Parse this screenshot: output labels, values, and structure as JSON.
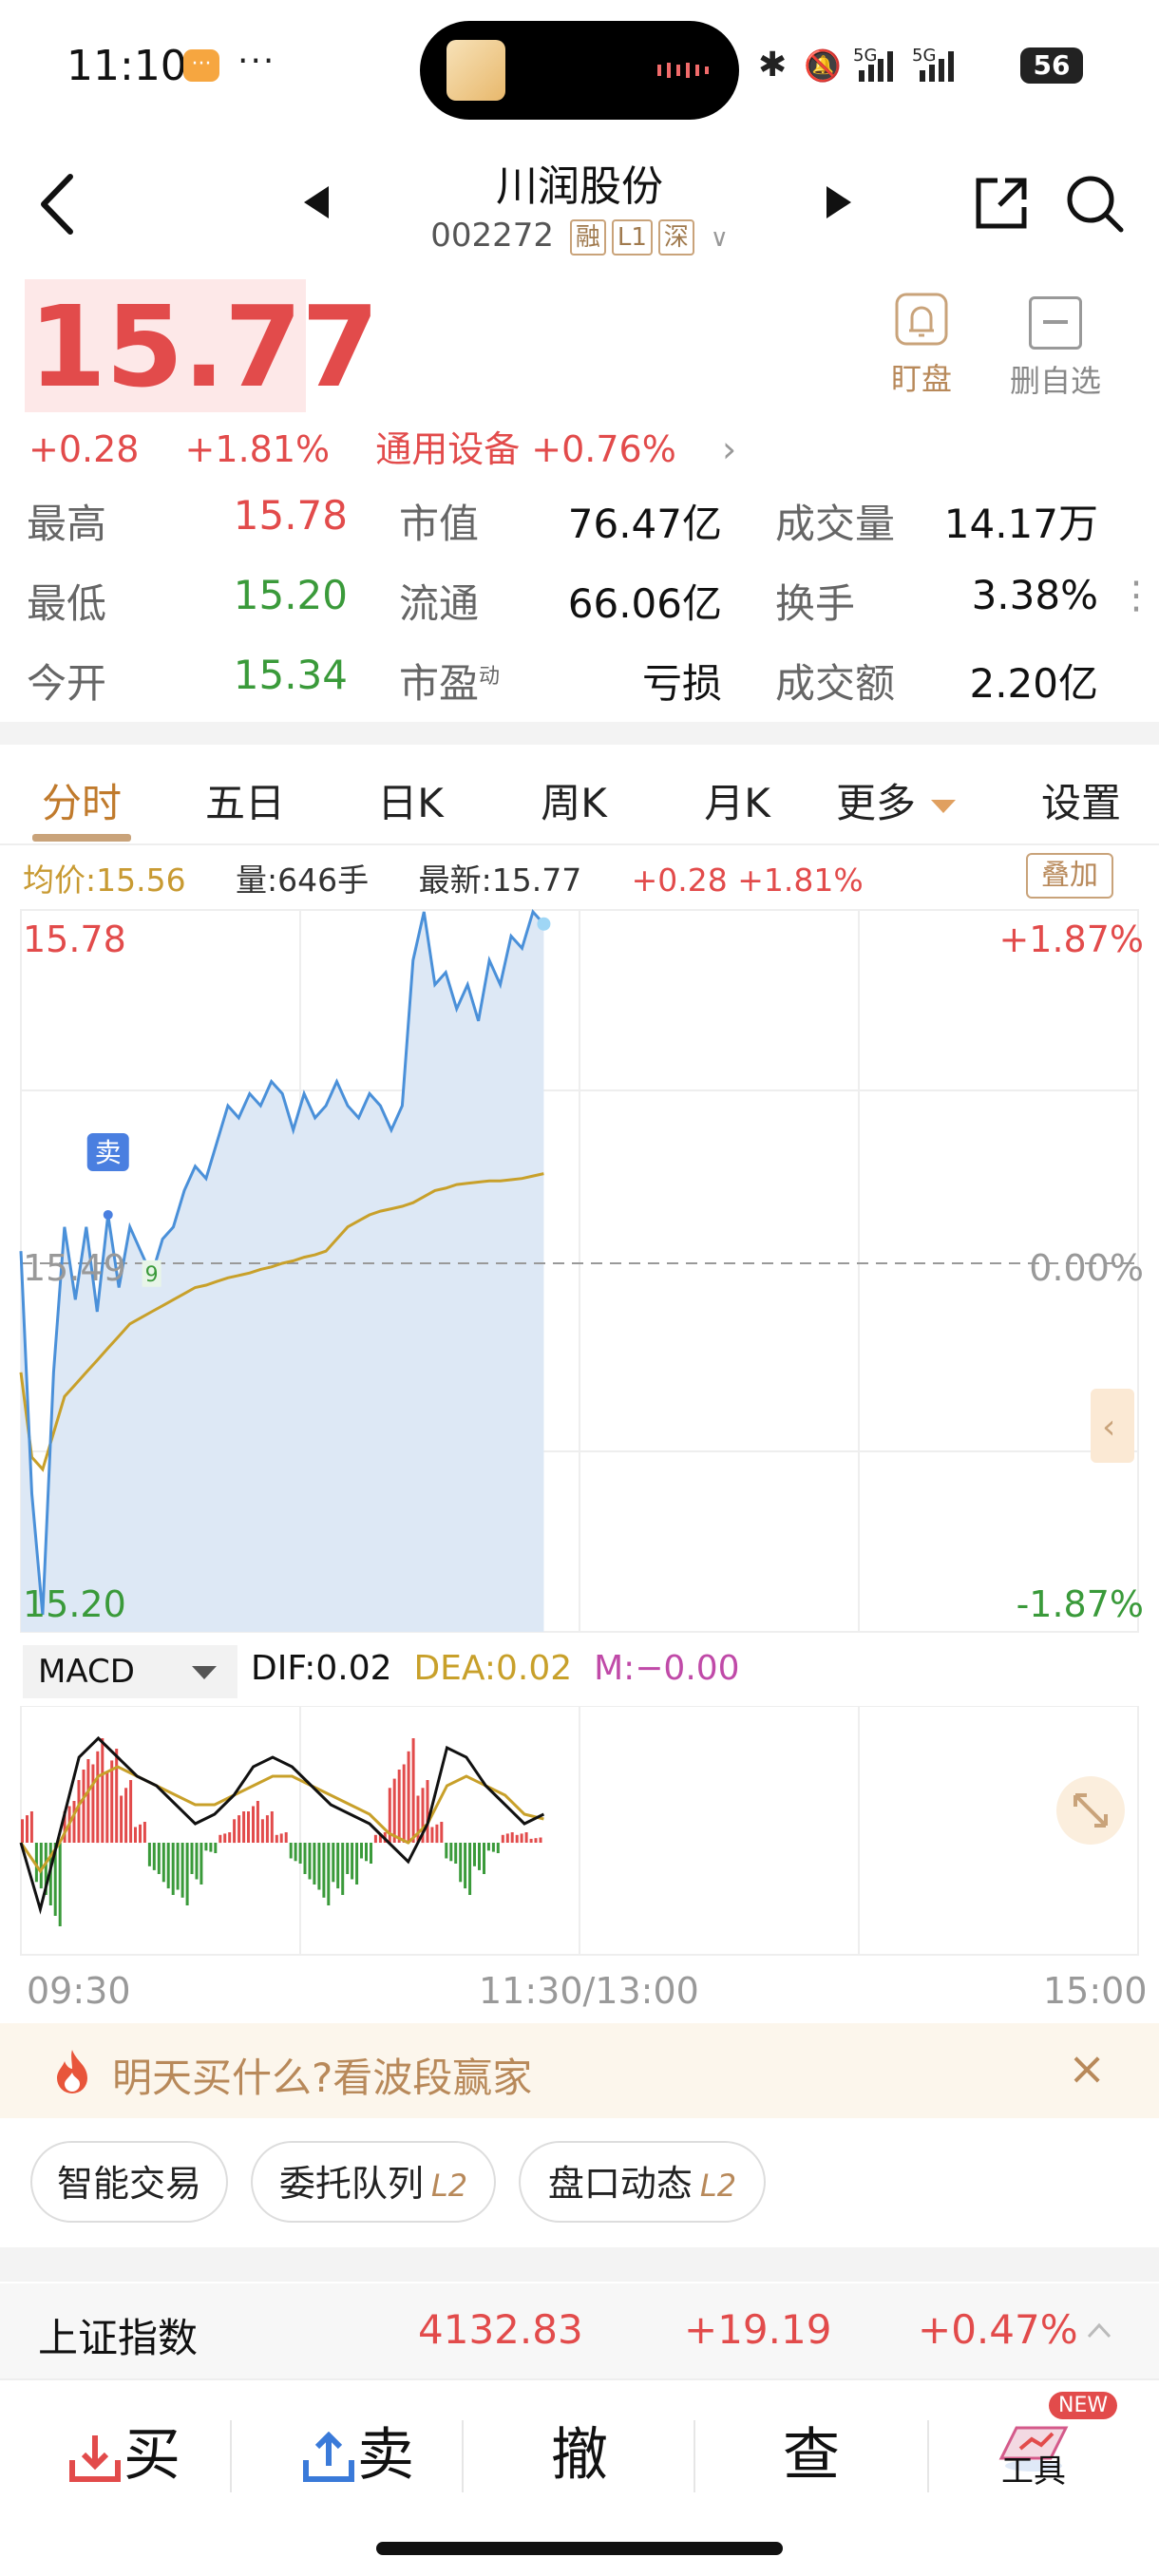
{
  "status_bar": {
    "time": "11:10",
    "more": "···",
    "network": "5G 5G",
    "battery": "56"
  },
  "header": {
    "stock_name": "川润股份",
    "stock_code": "002272",
    "tags": [
      "融",
      "L1",
      "深"
    ]
  },
  "quote": {
    "price": "15.77",
    "change": "+0.28",
    "change_pct": "+1.81%",
    "sector": "通用设备 +0.76%",
    "watch_label": "盯盘",
    "delete_fav_label": "删自选",
    "price_color": "#e24b4b",
    "down_color": "#3a9a3a"
  },
  "stats": {
    "high_label": "最高",
    "high_value": "15.78",
    "low_label": "最低",
    "low_value": "15.20",
    "open_label": "今开",
    "open_value": "15.34",
    "mktcap_label": "市值",
    "mktcap_value": "76.47亿",
    "float_label": "流通",
    "float_value": "66.06亿",
    "pe_label": "市盈",
    "pe_sup": "动",
    "pe_value": "亏损",
    "volume_label": "成交量",
    "volume_value": "14.17万",
    "turnover_label": "换手",
    "turnover_value": "3.38%",
    "amount_label": "成交额",
    "amount_value": "2.20亿"
  },
  "tabs": [
    "分时",
    "五日",
    "日K",
    "周K",
    "月K",
    "更多",
    "设置"
  ],
  "chart_info": {
    "avg_price": "均价:15.56",
    "volume": "量:646手",
    "latest": "最新:15.77",
    "change": "+0.28 +1.81%",
    "overlay_button": "叠加"
  },
  "chart_data": {
    "type": "line",
    "y_left_top": "15.78",
    "y_left_mid": "15.49",
    "y_left_bottom": "15.20",
    "y_right_top": "+1.87%",
    "y_right_mid": "0.00%",
    "y_right_bottom": "-1.87%",
    "ylim": [
      15.2,
      15.78
    ],
    "prev_close": 15.49,
    "series": [
      {
        "name": "价格",
        "color": "#4a90d9",
        "values": [
          15.5,
          15.3,
          15.2,
          15.4,
          15.52,
          15.46,
          15.52,
          15.45,
          15.53,
          15.47,
          15.52,
          15.5,
          15.48,
          15.51,
          15.52,
          15.55,
          15.57,
          15.56,
          15.59,
          15.62,
          15.61,
          15.63,
          15.62,
          15.64,
          15.63,
          15.6,
          15.63,
          15.61,
          15.62,
          15.64,
          15.62,
          15.61,
          15.63,
          15.62,
          15.6,
          15.62,
          15.74,
          15.78,
          15.72,
          15.73,
          15.7,
          15.72,
          15.69,
          15.74,
          15.72,
          15.76,
          15.75,
          15.78,
          15.77
        ]
      },
      {
        "name": "均价",
        "color": "#c8a02a",
        "values": [
          15.4,
          15.33,
          15.32,
          15.35,
          15.38,
          15.39,
          15.4,
          15.41,
          15.42,
          15.43,
          15.44,
          15.445,
          15.45,
          15.455,
          15.46,
          15.465,
          15.47,
          15.472,
          15.475,
          15.478,
          15.48,
          15.482,
          15.485,
          15.487,
          15.49,
          15.492,
          15.495,
          15.497,
          15.5,
          15.51,
          15.52,
          15.525,
          15.53,
          15.533,
          15.535,
          15.537,
          15.54,
          15.545,
          15.55,
          15.552,
          15.555,
          15.556,
          15.557,
          15.558,
          15.558,
          15.559,
          15.56,
          15.562,
          15.564
        ]
      }
    ],
    "markers": [
      {
        "label": "卖",
        "index": 8
      },
      {
        "label": "9",
        "index": 12
      }
    ]
  },
  "macd": {
    "selector": "MACD",
    "dif": "DIF:0.02",
    "dea": "DEA:0.02",
    "m": "M:−0.00",
    "dif_color": "#111111",
    "dea_color": "#c8a02a",
    "m_color": "#c04aa8",
    "hist": [
      0.3,
      -0.5,
      -0.8,
      0.4,
      0.8,
      1.0,
      0.9,
      0.6,
      0.2,
      -0.3,
      -0.5,
      -0.6,
      -0.4,
      -0.1,
      0.1,
      0.3,
      0.4,
      0.3,
      0.1,
      -0.2,
      -0.4,
      -0.6,
      -0.5,
      -0.4,
      -0.2,
      0.1,
      0.7,
      1.0,
      0.6,
      0.2,
      -0.2,
      -0.5,
      -0.3,
      -0.1,
      0.1,
      0.1,
      0.05
    ],
    "dif_line": [
      0.0,
      -0.7,
      0.1,
      0.9,
      1.1,
      0.9,
      0.7,
      0.6,
      0.4,
      0.2,
      0.3,
      0.5,
      0.8,
      0.9,
      0.8,
      0.6,
      0.4,
      0.3,
      0.2,
      0.0,
      -0.2,
      0.2,
      1.0,
      0.9,
      0.6,
      0.4,
      0.2,
      0.3
    ],
    "dea_line": [
      0.0,
      -0.3,
      0.0,
      0.4,
      0.7,
      0.8,
      0.7,
      0.6,
      0.5,
      0.4,
      0.4,
      0.5,
      0.6,
      0.7,
      0.7,
      0.6,
      0.5,
      0.4,
      0.3,
      0.1,
      0.0,
      0.2,
      0.6,
      0.7,
      0.6,
      0.5,
      0.3,
      0.25
    ]
  },
  "time_axis": {
    "start": "09:30",
    "mid": "11:30/13:00",
    "end": "15:00"
  },
  "promo": {
    "text": "明天买什么?看波段赢家"
  },
  "chips": [
    {
      "label": "智能交易",
      "badge": ""
    },
    {
      "label": "委托队列",
      "badge": "L2"
    },
    {
      "label": "盘口动态",
      "badge": "L2"
    }
  ],
  "index_bar": {
    "name": "上证指数",
    "value": "4132.83",
    "change": "+19.19",
    "change_pct": "+0.47%"
  },
  "actions": {
    "buy": "买",
    "sell": "卖",
    "cancel": "撤",
    "query": "查",
    "tools": "工具",
    "new_badge": "NEW"
  }
}
